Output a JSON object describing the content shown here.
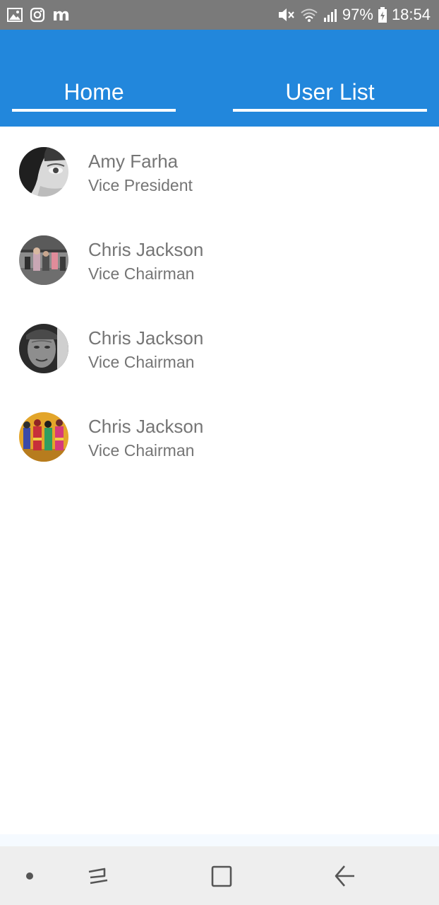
{
  "status_bar": {
    "battery": "97%",
    "time": "18:54",
    "left_icons": [
      "gallery-icon",
      "instagram-icon",
      "m-icon"
    ],
    "m_letter": "m",
    "right_icons": [
      "mute-icon",
      "wifi-icon",
      "signal-icon",
      "battery-icon"
    ]
  },
  "tabs": [
    {
      "label": "Home"
    },
    {
      "label": "User List"
    }
  ],
  "users": [
    {
      "name": "Amy Farha",
      "title": "Vice President"
    },
    {
      "name": "Chris Jackson",
      "title": "Vice Chairman"
    },
    {
      "name": "Chris Jackson",
      "title": "Vice Chairman"
    },
    {
      "name": "Chris Jackson",
      "title": "Vice Chairman"
    }
  ],
  "nav_bar": {
    "icons": [
      "nav-dot-icon",
      "recent-apps-icon",
      "home-icon",
      "back-icon"
    ]
  },
  "colors": {
    "app_bar": "#2287dc",
    "status_bar": "#7a7a7a",
    "list_text": "#757575",
    "nav_bar": "#eeeeee"
  }
}
